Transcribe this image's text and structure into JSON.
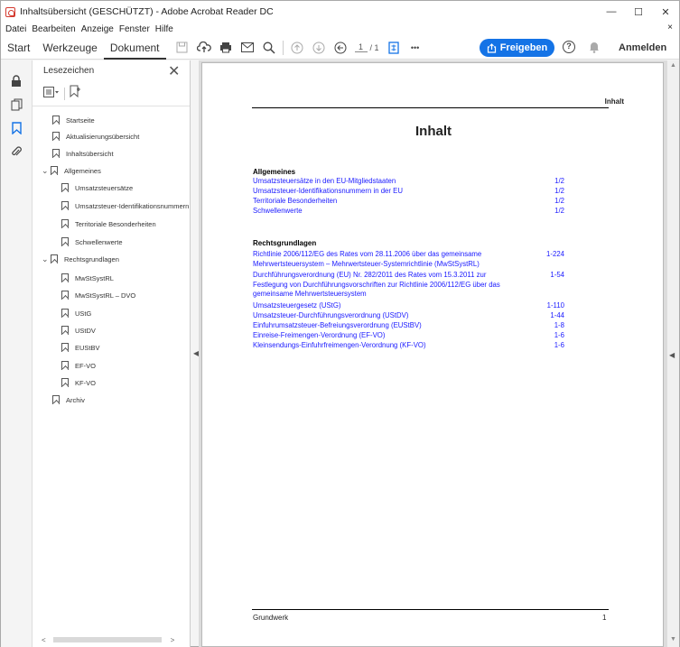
{
  "window": {
    "title": "Inhaltsübersicht (GESCHÜTZT) - Adobe Acrobat Reader DC",
    "minimize": "—",
    "maximize": "☐",
    "close": "✕"
  },
  "menu": {
    "items": [
      "Datei",
      "Bearbeiten",
      "Anzeige",
      "Fenster",
      "Hilfe"
    ],
    "close": "×"
  },
  "toolbar": {
    "tabs": [
      "Start",
      "Werkzeuge",
      "Dokument"
    ],
    "active_tab": "Dokument",
    "page_current": "1",
    "page_total": "/ 1",
    "more": "•••",
    "share_label": "Freigeben",
    "signin_label": "Anmelden"
  },
  "bookmarks_panel": {
    "title": "Lesezeichen",
    "close": "✕",
    "items": [
      {
        "label": "Startseite",
        "level": 0,
        "expanded": null
      },
      {
        "label": "Aktualisierungsübersicht",
        "level": 0,
        "expanded": null
      },
      {
        "label": "Inhaltsübersicht",
        "level": 0,
        "expanded": null
      },
      {
        "label": "Allgemeines",
        "level": 0,
        "expanded": true
      },
      {
        "label": "Umsatzsteuersätze",
        "level": 1,
        "expanded": null
      },
      {
        "label": "Umsatzsteuer-Identifikationsnummern",
        "level": 1,
        "expanded": null
      },
      {
        "label": "Territoriale Besonderheiten",
        "level": 1,
        "expanded": null
      },
      {
        "label": "Schwellenwerte",
        "level": 1,
        "expanded": null
      },
      {
        "label": "Rechtsgrundlagen",
        "level": 0,
        "expanded": true
      },
      {
        "label": "MwStSystRL",
        "level": 1,
        "expanded": null
      },
      {
        "label": "MwStSystRL – DVO",
        "level": 1,
        "expanded": null
      },
      {
        "label": "UStG",
        "level": 1,
        "expanded": null
      },
      {
        "label": "UStDV",
        "level": 1,
        "expanded": null
      },
      {
        "label": "EUStBV",
        "level": 1,
        "expanded": null
      },
      {
        "label": "EF-VO",
        "level": 1,
        "expanded": null
      },
      {
        "label": "KF-VO",
        "level": 1,
        "expanded": null
      },
      {
        "label": "Archiv",
        "level": 0,
        "expanded": null
      }
    ],
    "chevron": "⌄"
  },
  "document": {
    "header": "Inhalt",
    "title": "Inhalt",
    "sections": [
      {
        "heading": "Allgemeines",
        "rows": [
          {
            "text": "Umsatzsteuersätze in den EU-Mitgliedstaaten",
            "page": "1/2"
          },
          {
            "text": "Umsatzsteuer-Identifikationsnummern in der EU",
            "page": "1/2"
          },
          {
            "text": "Territoriale Besonderheiten",
            "page": "1/2"
          },
          {
            "text": "Schwellenwerte",
            "page": "1/2"
          }
        ]
      },
      {
        "heading": "Rechtsgrundlagen",
        "rows": [
          {
            "text": "Richtlinie 2006/112/EG des Rates vom 28.11.2006 über das gemeinsame Mehrwertsteuersystem – Mehrwertsteuer-Systemrichtlinie (MwStSystRL)",
            "page": "1-224"
          },
          {
            "text": "Durchführungsverordnung (EU) Nr. 282/2011 des Rates vom 15.3.2011 zur Festlegung von Durchführungsvorschriften zur Richtlinie 2006/112/EG über das gemeinsame Mehrwertsteuersystem",
            "page": "1-54"
          },
          {
            "text": "Umsatzsteuergesetz (UStG)",
            "page": "1-110"
          },
          {
            "text": "Umsatzsteuer-Durchführungsverordnung (UStDV)",
            "page": "1-44"
          },
          {
            "text": "Einfuhrumsatzsteuer-Befreiungsverordnung (EUStBV)",
            "page": "1-8"
          },
          {
            "text": "Einreise-Freimengen-Verordnung (EF-VO)",
            "page": "1-6"
          },
          {
            "text": "Kleinsendungs-Einfuhrfreimengen-Verordnung (KF-VO)",
            "page": "1-6"
          }
        ]
      }
    ],
    "footer_left": "Grundwerk",
    "footer_page": "1"
  },
  "colors": {
    "accent": "#1473e6",
    "link": "#1a1aff"
  }
}
